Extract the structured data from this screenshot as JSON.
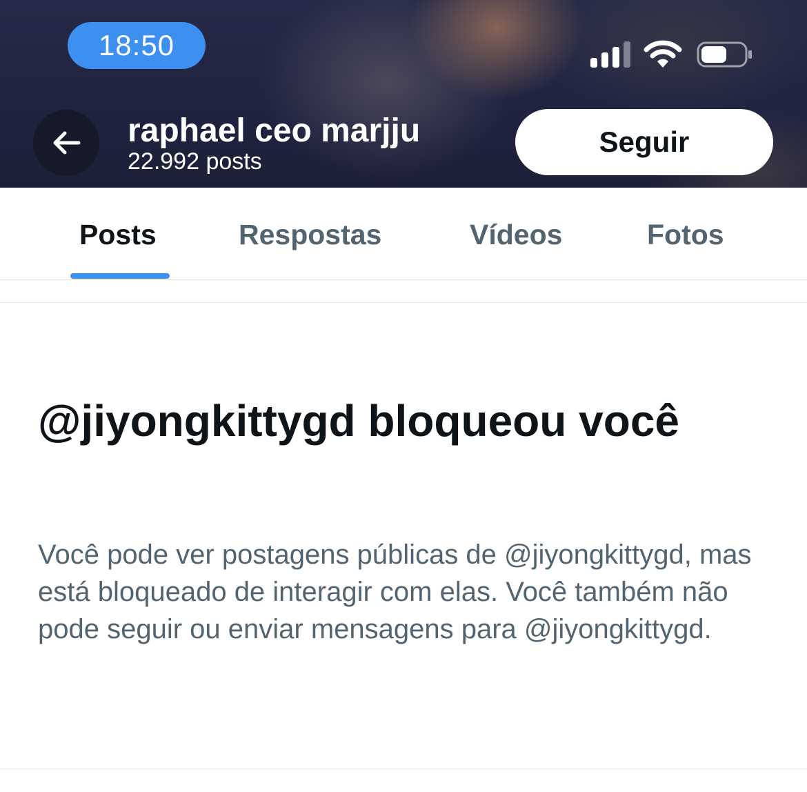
{
  "status_bar": {
    "time": "18:50",
    "icons": [
      "cellular-signal-icon",
      "wifi-icon",
      "battery-icon"
    ]
  },
  "header": {
    "back_icon": "arrow-left-icon",
    "profile_name": "raphael ceo marjju",
    "post_count": "22.992 posts",
    "follow_label": "Seguir"
  },
  "tabs": [
    {
      "label": "Posts",
      "active": true
    },
    {
      "label": "Respostas",
      "active": false
    },
    {
      "label": "Vídeos",
      "active": false
    },
    {
      "label": "Fotos",
      "active": false
    }
  ],
  "blocked": {
    "title": "@jiyongkittygd bloqueou você",
    "description": "Você pode ver postagens públicas de @jiyongkittygd, mas está bloqueado de interagir com elas. Você também não pode seguir ou enviar mensagens para @jiyongkittygd."
  },
  "colors": {
    "accent": "#3d8ff0",
    "text_primary": "#0f1419",
    "text_secondary": "#536471",
    "header_bg": "#222640"
  }
}
